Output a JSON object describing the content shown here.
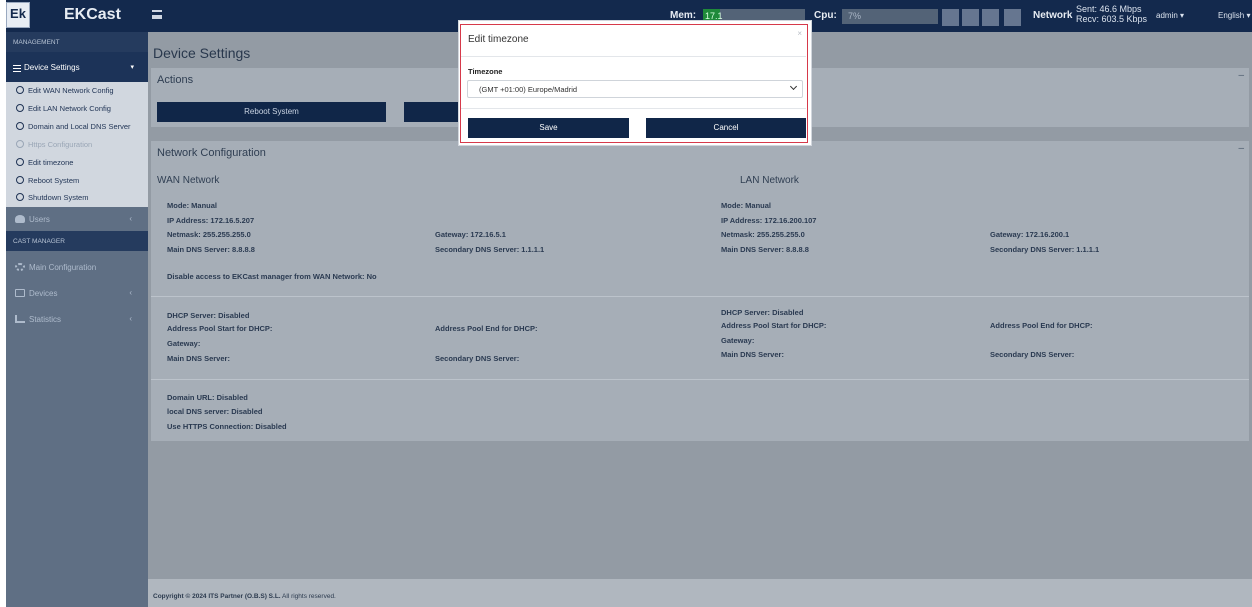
{
  "topbar": {
    "logo_text": "Ek",
    "brand": "EKCast",
    "mem_label": "Mem:",
    "mem_value": "17.1",
    "cpu_label": "Cpu:",
    "cpu_value": "7%",
    "network_label": "Network",
    "sent": "Sent: 46.6 Mbps",
    "recv": "Recv: 603.5 Kbps",
    "user_menu": "admin ▾",
    "language_menu": "English ▾"
  },
  "sidebar": {
    "management_header": "MANAGEMENT",
    "device_settings": "Device Settings",
    "subitems": [
      "Edit WAN Network Config",
      "Edit LAN Network Config",
      "Domain and Local DNS Server",
      "Https Configuration",
      "Edit timezone",
      "Reboot System",
      "Shutdown System"
    ],
    "users": "Users",
    "cast_header": "CAST MANAGER",
    "main_configuration": "Main Configuration",
    "devices": "Devices",
    "statistics": "Statistics"
  },
  "main": {
    "page_title": "Device Settings",
    "actions_title": "Actions",
    "reboot_button": "Reboot System",
    "network_title": "Network Configuration",
    "wan": {
      "title": "WAN Network",
      "mode": "Mode: Manual",
      "ip": "IP Address: 172.16.5.207",
      "netmask": "Netmask: 255.255.255.0",
      "gateway": "Gateway: 172.16.5.1",
      "main_dns": "Main DNS Server: 8.8.8.8",
      "secondary_dns": "Secondary DNS Server: 1.1.1.1",
      "disable_access": "Disable access to EKCast manager from WAN Network: No"
    },
    "lan": {
      "title": "LAN Network",
      "mode": "Mode: Manual",
      "ip": "IP Address: 172.16.200.107",
      "netmask": "Netmask: 255.255.255.0",
      "gateway": "Gateway: 172.16.200.1",
      "main_dns": "Main DNS Server: 8.8.8.8",
      "secondary_dns": "Secondary DNS Server: 1.1.1.1"
    },
    "dhcp_wan": {
      "status": "DHCP Server: Disabled",
      "pool_start": "Address Pool Start for DHCP:",
      "pool_end": "Address Pool End for DHCP:",
      "gateway": "Gateway:",
      "main_dns": "Main DNS Server:",
      "secondary_dns": "Secondary DNS Server:"
    },
    "dhcp_lan": {
      "status": "DHCP Server: Disabled",
      "pool_start": "Address Pool Start for DHCP:",
      "pool_end": "Address Pool End for DHCP:",
      "gateway": "Gateway:",
      "main_dns": "Main DNS Server:",
      "secondary_dns": "Secondary DNS Server:"
    },
    "domain": {
      "url": "Domain URL: Disabled",
      "local_dns": "local DNS server: Disabled",
      "https": "Use HTTPS Connection: Disabled"
    },
    "footer_copyright": "Copyright © 2024 ITS Partner (O.B.S) S.L.",
    "footer_rights": " All rights reserved."
  },
  "modal": {
    "title": "Edit timezone",
    "close": "×",
    "timezone_label": "Timezone",
    "timezone_value": "(GMT +01:00) Europe/Madrid",
    "save": "Save",
    "cancel": "Cancel"
  },
  "colors": {
    "navy": "#102648",
    "modal_border": "#d6394a",
    "mem_fill": "#1f8a3a"
  },
  "mem_fraction": 0.17
}
